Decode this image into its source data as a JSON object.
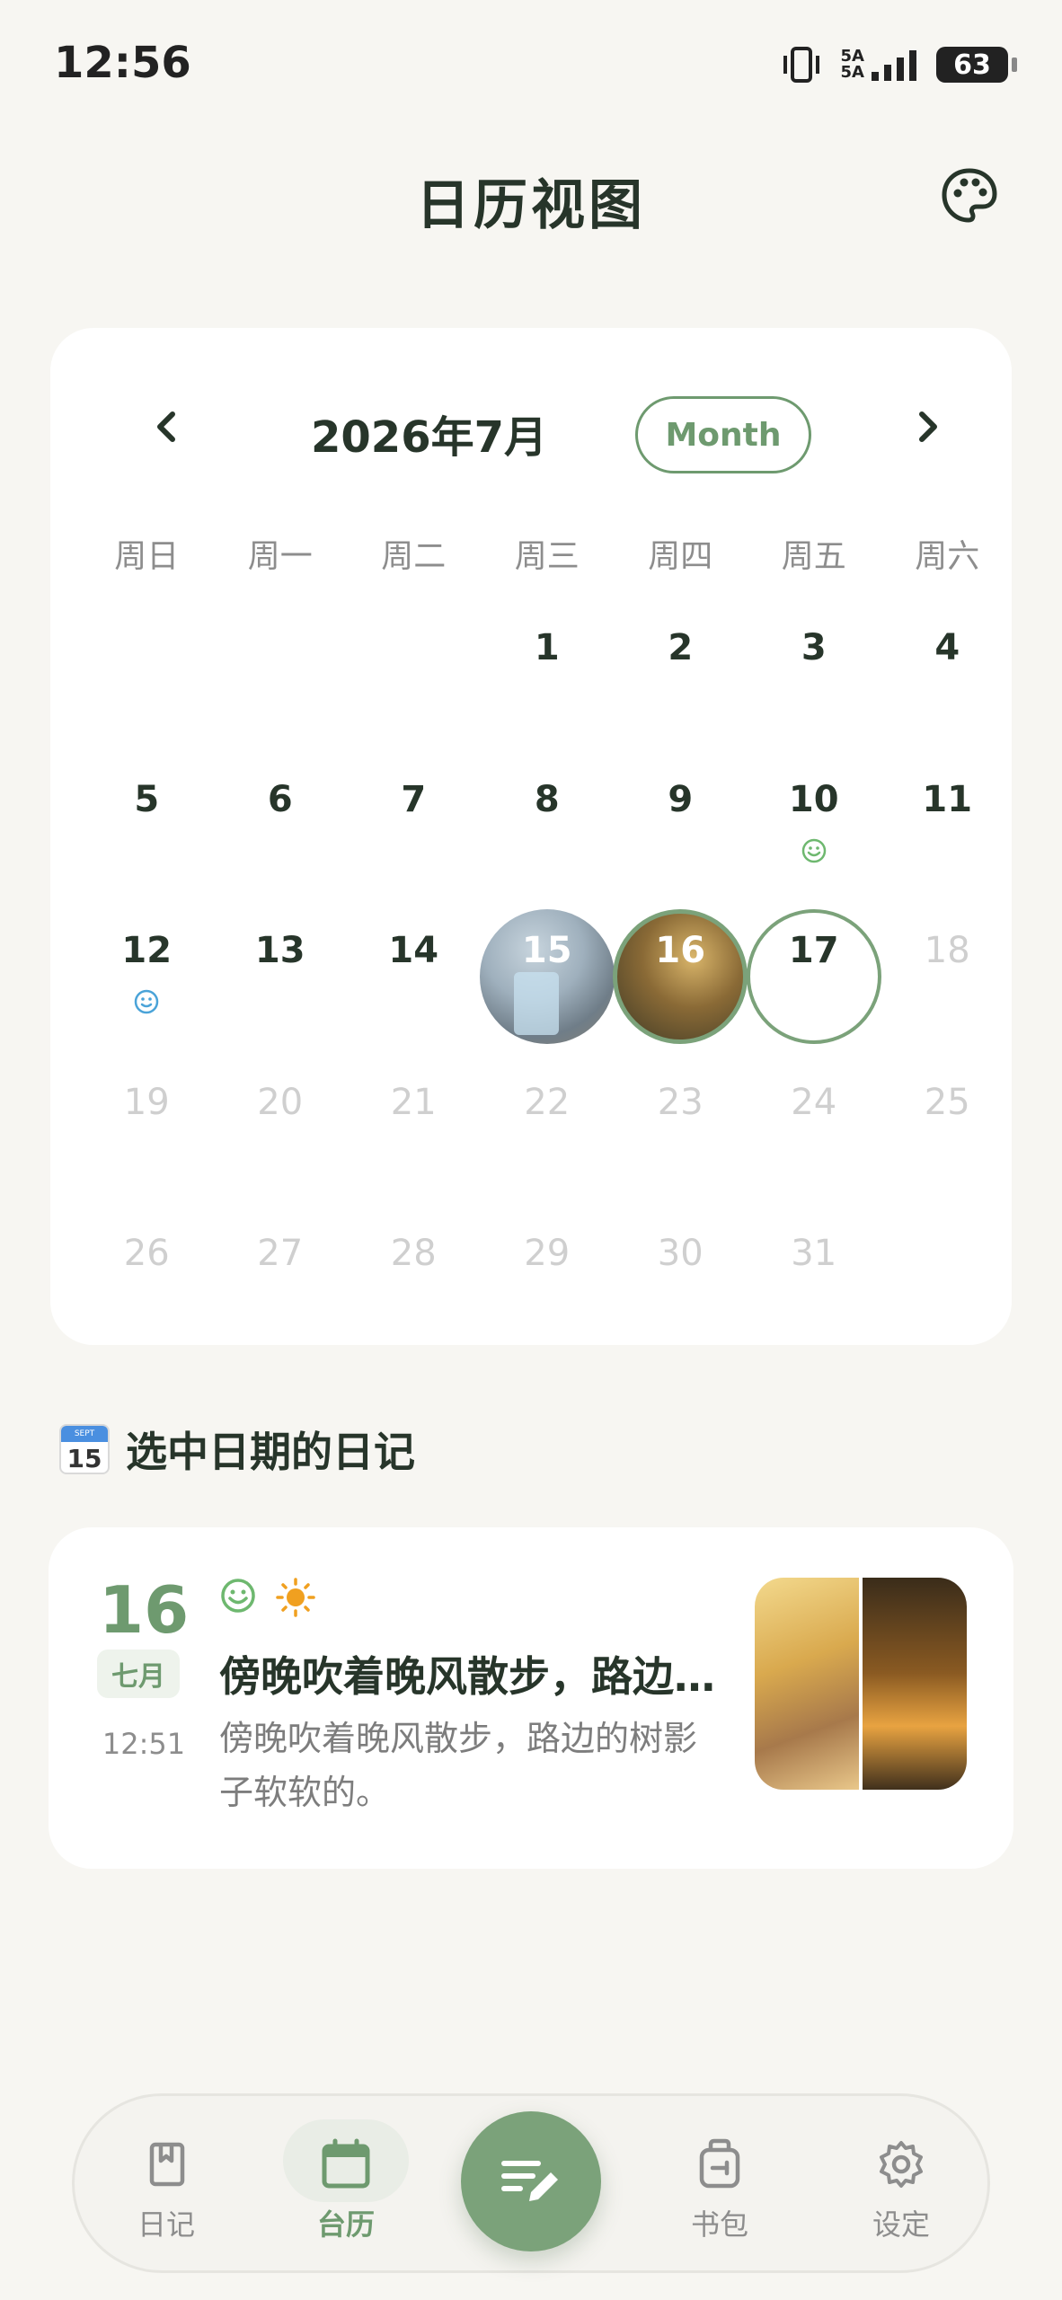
{
  "status_bar": {
    "time": "12:56",
    "battery": "63",
    "signal_top": "5A",
    "signal_bottom": "5A"
  },
  "header": {
    "title": "日历视图",
    "palette_icon": "palette-icon"
  },
  "calendar": {
    "month_label": "2026年7月",
    "mode_button": "Month",
    "weekdays": [
      "周日",
      "周一",
      "周二",
      "周三",
      "周四",
      "周五",
      "周六"
    ],
    "days": {
      "d1": "1",
      "d2": "2",
      "d3": "3",
      "d4": "4",
      "d5": "5",
      "d6": "6",
      "d7": "7",
      "d8": "8",
      "d9": "9",
      "d10": "10",
      "d11": "11",
      "d12": "12",
      "d13": "13",
      "d14": "14",
      "d15": "15",
      "d16": "16",
      "d17": "17",
      "d18": "18",
      "d19": "19",
      "d20": "20",
      "d21": "21",
      "d22": "22",
      "d23": "23",
      "d24": "24",
      "d25": "25",
      "d26": "26",
      "d27": "27",
      "d28": "28",
      "d29": "29",
      "d30": "30",
      "d31": "31"
    },
    "today": "17",
    "selected": "16",
    "accent_color": "#7ba27a"
  },
  "selected_section": {
    "emoji_month": "SEPT",
    "emoji_day": "15",
    "title": "选中日期的日记"
  },
  "entry": {
    "day": "16",
    "month": "七月",
    "time": "12:51",
    "title": "傍晚吹着晚风散步，路边的树影子软软的。",
    "body": "傍晚吹着晚风散步，路边的树影子软软的。"
  },
  "nav": {
    "diary": "日记",
    "calendar": "台历",
    "bag": "书包",
    "settings": "设定"
  }
}
